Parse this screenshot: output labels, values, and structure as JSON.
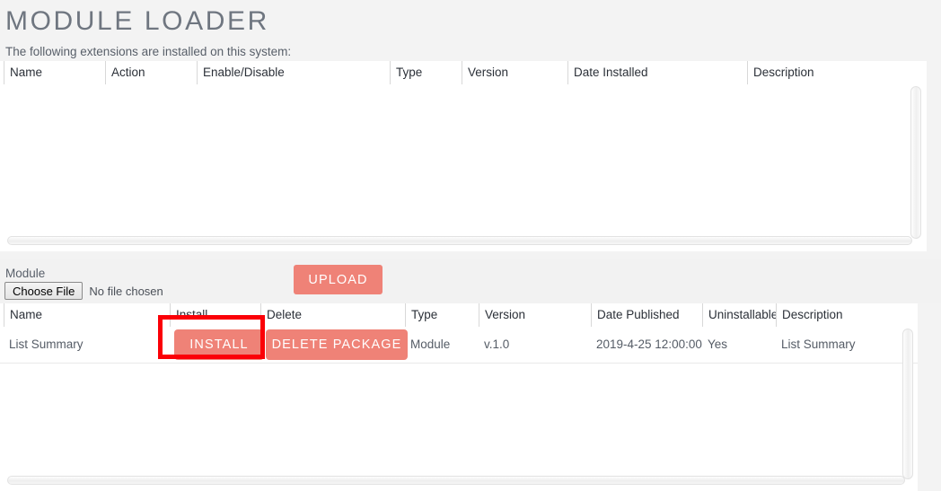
{
  "page": {
    "title": "MODULE LOADER",
    "intro": "The following extensions are installed on this system:",
    "background_color": "#f3f3f3",
    "accent_color": "#ef8277",
    "highlight_color": "#fb0007"
  },
  "installed_grid": {
    "columns": [
      "Name",
      "Action",
      "Enable/Disable",
      "Type",
      "Version",
      "Date Installed",
      "Description"
    ],
    "rows": []
  },
  "upload": {
    "module_label": "Module",
    "choose_file_label": "Choose File",
    "file_status": "No file chosen",
    "upload_button": "UPLOAD"
  },
  "packages_grid": {
    "columns": [
      "Name",
      "Install",
      "Delete",
      "Type",
      "Version",
      "Date Published",
      "Uninstallable",
      "Description"
    ],
    "rows": [
      {
        "name": "List Summary",
        "install_label": "INSTALL",
        "delete_label": "DELETE PACKAGE",
        "type": "Module",
        "version": "v.1.0",
        "date_published": "2019-4-25 12:00:00",
        "uninstallable": "Yes",
        "description": "List Summary"
      }
    ]
  }
}
